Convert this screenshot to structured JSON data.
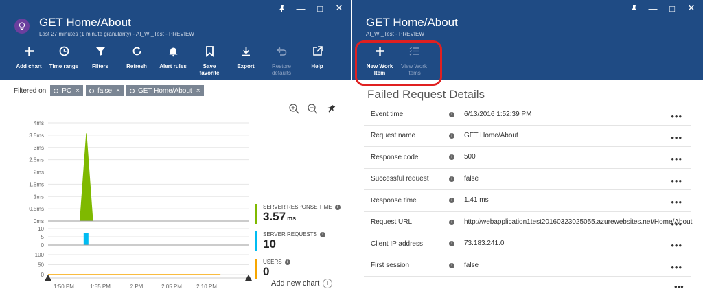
{
  "left_blade": {
    "title": "GET Home/About",
    "subtitle": "Last 27 minutes (1 minute granularity) - AI_WI_Test - PREVIEW",
    "toolbar": [
      {
        "label": "Add chart",
        "icon": "plus-icon",
        "disabled": false
      },
      {
        "label": "Time range",
        "icon": "clock-icon",
        "disabled": false
      },
      {
        "label": "Filters",
        "icon": "filter-icon",
        "disabled": false
      },
      {
        "label": "Refresh",
        "icon": "refresh-icon",
        "disabled": false
      },
      {
        "label": "Alert rules",
        "icon": "bell-icon",
        "disabled": false
      },
      {
        "label": "Save\nfavorite",
        "icon": "bookmark-icon",
        "disabled": false
      },
      {
        "label": "Export",
        "icon": "download-icon",
        "disabled": false
      },
      {
        "label": "Restore\ndefaults",
        "icon": "undo-icon",
        "disabled": true
      },
      {
        "label": "Help",
        "icon": "external-link-icon",
        "disabled": false
      }
    ],
    "filtered_on_label": "Filtered on",
    "filters": [
      {
        "label": "PC",
        "close": "×"
      },
      {
        "label": "false",
        "close": "×"
      },
      {
        "label": "GET Home/About",
        "close": "×"
      }
    ],
    "metrics": [
      {
        "label": "SERVER RESPONSE TIME",
        "value": "3.57",
        "unit": "ms",
        "color": "#7fb900"
      },
      {
        "label": "SERVER REQUESTS",
        "value": "10",
        "unit": "",
        "color": "#00bcf2"
      },
      {
        "label": "USERS",
        "value": "0",
        "unit": "",
        "color": "#f7a600"
      }
    ],
    "add_chart_label": "Add new chart",
    "add_chart_icon": "+"
  },
  "right_blade": {
    "title": "GET Home/About",
    "subtitle": "AI_WI_Test - PREVIEW",
    "toolbar": [
      {
        "label": "New Work\nItem",
        "icon": "plus-icon",
        "disabled": false
      },
      {
        "label": "View Work\nItems",
        "icon": "checklist-icon",
        "disabled": true
      }
    ],
    "section_title": "Failed Request Details",
    "details": [
      {
        "label": "Event time",
        "value": "6/13/2016 1:52:39 PM"
      },
      {
        "label": "Request name",
        "value": "GET Home/About"
      },
      {
        "label": "Response code",
        "value": "500"
      },
      {
        "label": "Successful request",
        "value": "false"
      },
      {
        "label": "Response time",
        "value": "1.41 ms"
      },
      {
        "label": "Request URL",
        "value": "http://webapplication1test20160323025055.azurewebsites.net/Home/About"
      },
      {
        "label": "Client IP address",
        "value": "73.183.241.0"
      },
      {
        "label": "First session",
        "value": "false"
      }
    ],
    "more_label": "•••",
    "info_glyph": "i"
  },
  "window_controls": {
    "pin": "pin-icon",
    "minimize": "—",
    "maximize": "□",
    "close": "✕"
  },
  "chart_data": [
    {
      "type": "area",
      "name": "Server response time",
      "x": [
        "1:46 PM",
        "1:47 PM",
        "1:48 PM",
        "1:49 PM",
        "1:50 PM",
        "1:51 PM",
        "1:52 PM",
        "1:53 PM",
        "1:54 PM",
        "1:55 PM",
        "1:56 PM",
        "1:57 PM",
        "1:58 PM",
        "1:59 PM",
        "2:00 PM",
        "2:01 PM",
        "2:02 PM",
        "2:03 PM",
        "2:04 PM",
        "2:05 PM",
        "2:06 PM",
        "2:07 PM",
        "2:08 PM",
        "2:09 PM",
        "2:10 PM",
        "2:11 PM",
        "2:12 PM",
        "2:13 PM"
      ],
      "values": [
        0,
        0,
        0,
        0,
        0,
        0,
        3.57,
        0,
        0,
        0,
        0,
        0,
        0,
        0,
        0,
        0,
        0,
        0,
        0,
        0,
        0,
        0,
        0,
        0,
        0,
        0,
        0,
        0
      ],
      "ylabels": [
        "0ms",
        "0.5ms",
        "1ms",
        "1.5ms",
        "2ms",
        "2.5ms",
        "3ms",
        "3.5ms",
        "4ms"
      ],
      "ylim": [
        0,
        4
      ],
      "color": "#7fb900"
    },
    {
      "type": "bar",
      "name": "Server requests",
      "values": [
        0,
        0,
        0,
        0,
        0,
        0,
        10,
        0,
        0,
        0,
        0,
        0,
        0,
        0,
        0,
        0,
        0,
        0,
        0,
        0,
        0,
        0,
        0,
        0,
        0,
        0,
        0,
        0
      ],
      "ylabels": [
        "0",
        "5",
        "10"
      ],
      "ylim": [
        0,
        10
      ],
      "color": "#00bcf2"
    },
    {
      "type": "line",
      "name": "Users",
      "values": [
        0,
        0,
        0,
        0,
        0,
        0,
        0,
        0,
        0,
        0,
        0,
        0,
        0,
        0,
        0,
        0,
        0,
        0,
        0,
        0,
        0,
        0,
        0,
        0,
        0,
        0,
        0,
        0
      ],
      "ylabels": [
        "0",
        "50",
        "100"
      ],
      "ylim": [
        0,
        100
      ],
      "color": "#f7a600",
      "xticks": [
        "1:50 PM",
        "1:55 PM",
        "2 PM",
        "2:05 PM",
        "2:10 PM"
      ]
    }
  ]
}
